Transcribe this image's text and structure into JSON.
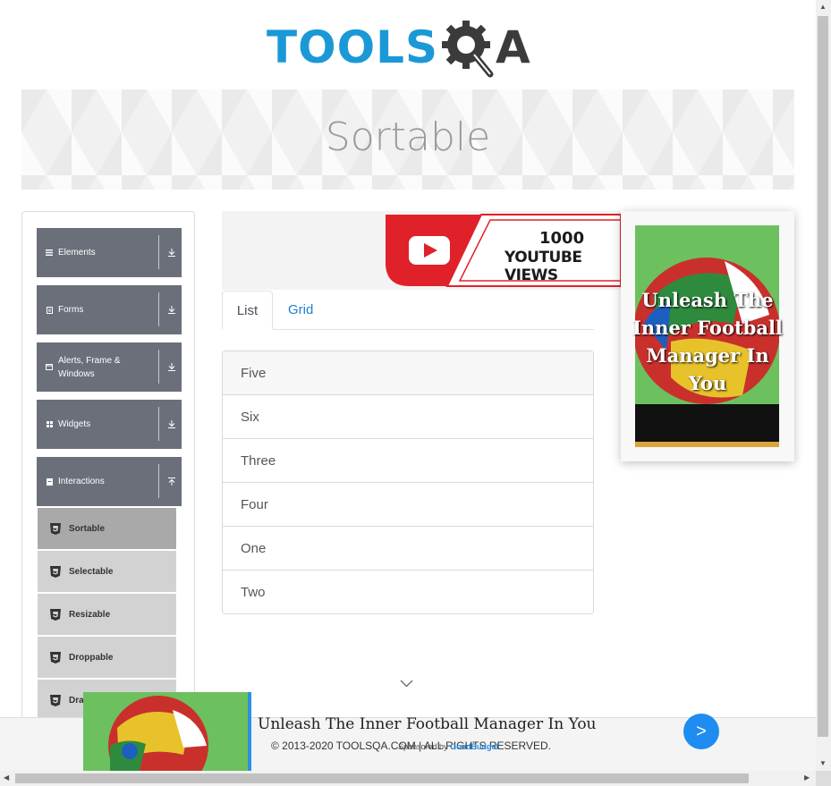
{
  "logo": {
    "text_main": "TOOLS",
    "text_q": "Q",
    "text_a": "A"
  },
  "banner": {
    "title": "Sortable"
  },
  "sidebar": {
    "groups": [
      {
        "label": "Elements",
        "icon": "hamburger-icon"
      },
      {
        "label": "Forms",
        "icon": "form-icon"
      },
      {
        "label": "Alerts, Frame & Windows",
        "icon": "window-icon"
      },
      {
        "label": "Widgets",
        "icon": "grid-icon"
      },
      {
        "label": "Interactions",
        "icon": "interaction-icon"
      }
    ],
    "items": [
      {
        "label": "Sortable",
        "active": true
      },
      {
        "label": "Selectable"
      },
      {
        "label": "Resizable"
      },
      {
        "label": "Droppable"
      },
      {
        "label": "Dra"
      }
    ]
  },
  "ad_top": {
    "line1": "1000",
    "line2": "YOUTUBE VIEWS"
  },
  "tabs": {
    "list": "List",
    "grid": "Grid"
  },
  "list": [
    "Five",
    "Six",
    "Three",
    "Four",
    "One",
    "Two"
  ],
  "side_ad": {
    "text": "Unleash The Inner Football Manager In You"
  },
  "footer": {
    "copyright": "© 2013-2020 TOOLSQA.COM | ALL RIGHTS RESERVED."
  },
  "bottom_ad": {
    "title": "Unleash The Inner Football Manager In You",
    "sponsored_prefix": "Sponsored by",
    "sponsor": "GoodBudget",
    "button": ">"
  },
  "colors": {
    "brand_blue": "#1a99d6",
    "sidebar_group": "#6b6f7a",
    "link_blue": "#1e7fd0",
    "ad_button": "#1e8cf0"
  }
}
